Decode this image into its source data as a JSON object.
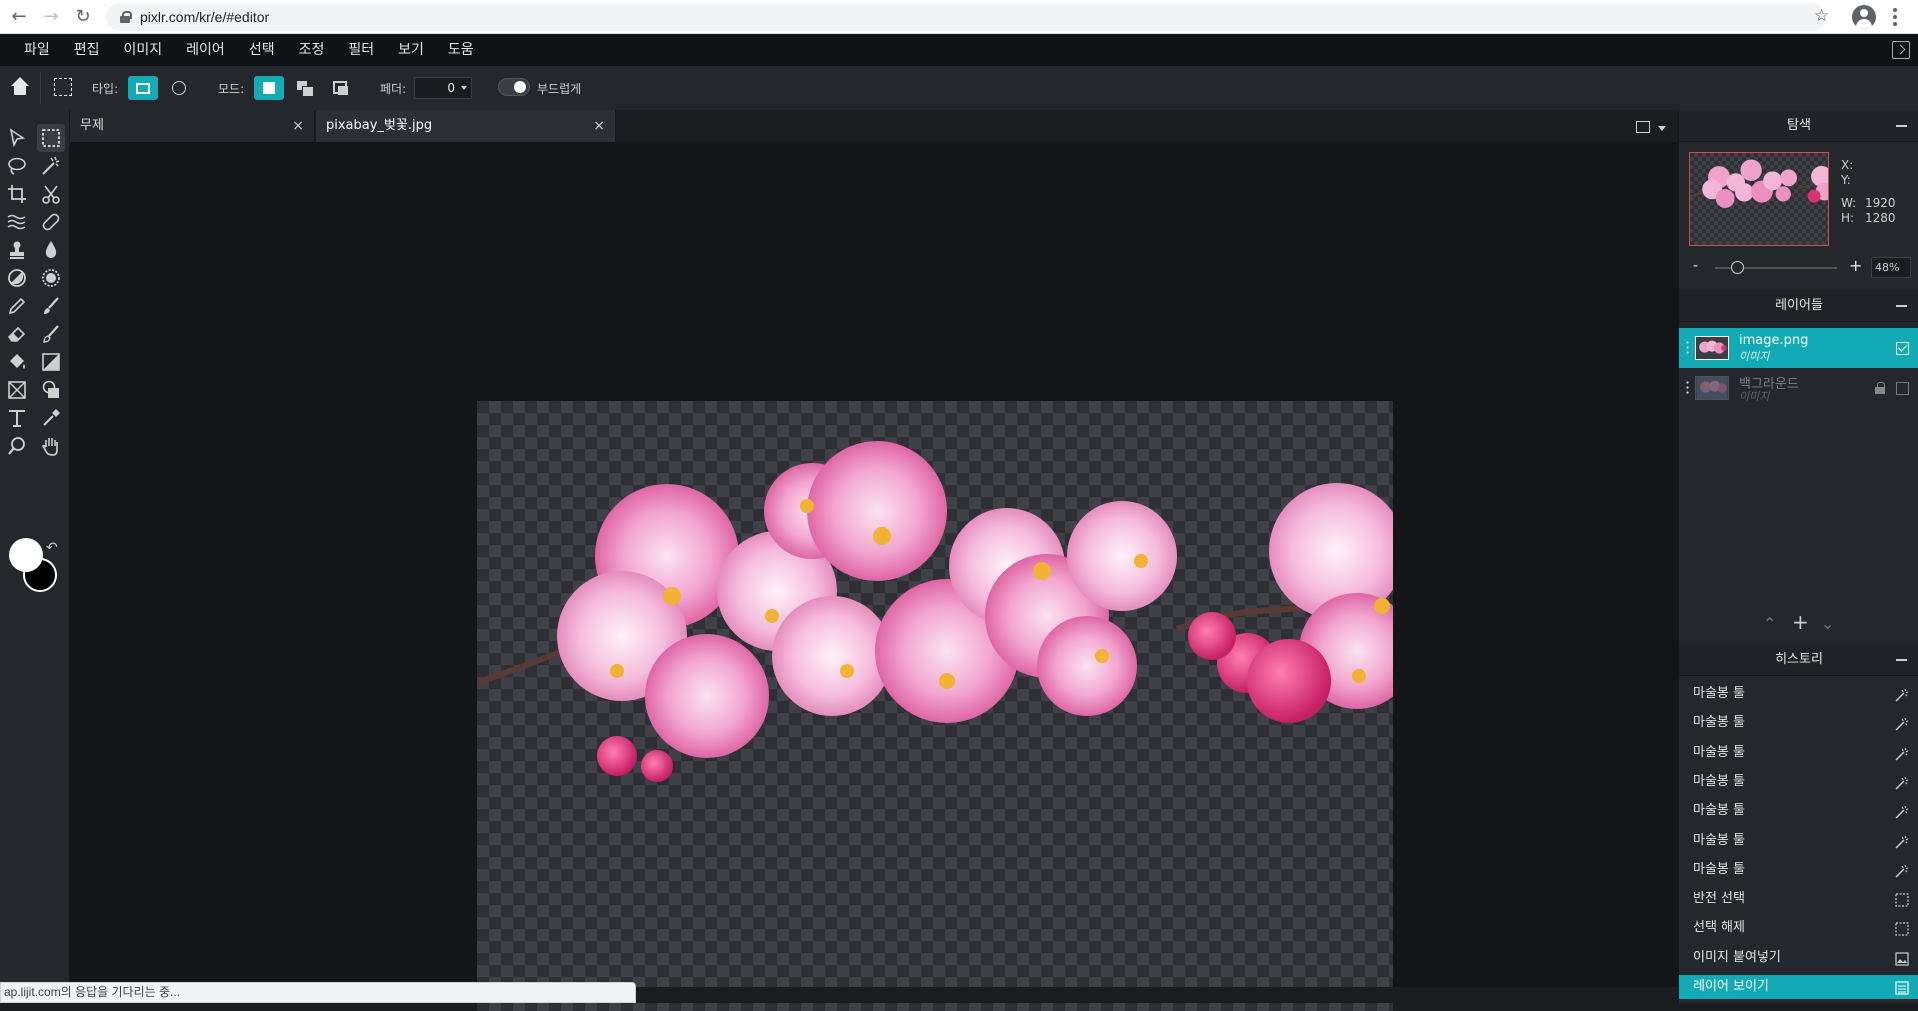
{
  "browser": {
    "url": "pixlr.com/kr/e/#editor"
  },
  "menu": [
    "파일",
    "편집",
    "이미지",
    "레이어",
    "선택",
    "조정",
    "필터",
    "보기",
    "도움"
  ],
  "options": {
    "type_label": "타입:",
    "mode_label": "모드:",
    "feather_label": "페더:",
    "feather_value": "0",
    "smooth_label": "부드럽게"
  },
  "tabs": [
    {
      "label": "무제",
      "close": "×"
    },
    {
      "label": "pixabay_벚꽃.jpg",
      "close": "×"
    }
  ],
  "navigator": {
    "title": "탐색",
    "x_label": "X:",
    "y_label": "Y:",
    "w_label": "W:",
    "w_value": "1920",
    "h_label": "H:",
    "h_value": "1280",
    "zoom_minus": "-",
    "zoom_plus": "+",
    "zoom_value": "48%"
  },
  "layers": {
    "title": "레이어들",
    "items": [
      {
        "name": "image.png",
        "type": "이미지",
        "active": true
      },
      {
        "name": "백그라운드",
        "type": "이미지",
        "active": false
      }
    ]
  },
  "history": {
    "title": "히스토리",
    "items": [
      {
        "label": "마술봉 툴",
        "icon": "magic-wand-icon"
      },
      {
        "label": "마술봉 툴",
        "icon": "magic-wand-icon"
      },
      {
        "label": "마술봉 툴",
        "icon": "magic-wand-icon"
      },
      {
        "label": "마술봉 툴",
        "icon": "magic-wand-icon"
      },
      {
        "label": "마술봉 툴",
        "icon": "magic-wand-icon"
      },
      {
        "label": "마술봉 툴",
        "icon": "magic-wand-icon"
      },
      {
        "label": "마술봉 툴",
        "icon": "magic-wand-icon"
      },
      {
        "label": "반전 선택",
        "icon": "selection-icon"
      },
      {
        "label": "선택 해제",
        "icon": "selection-icon"
      },
      {
        "label": "이미지 붙여넣기",
        "icon": "image-icon"
      },
      {
        "label": "레이어 보이기",
        "icon": "layer-icon"
      }
    ]
  },
  "status": "ap.lijit.com의 응답을 기다리는 중...",
  "colors": {
    "accent": "#12aab5",
    "foreground": "#ffffff",
    "background": "#000000"
  }
}
